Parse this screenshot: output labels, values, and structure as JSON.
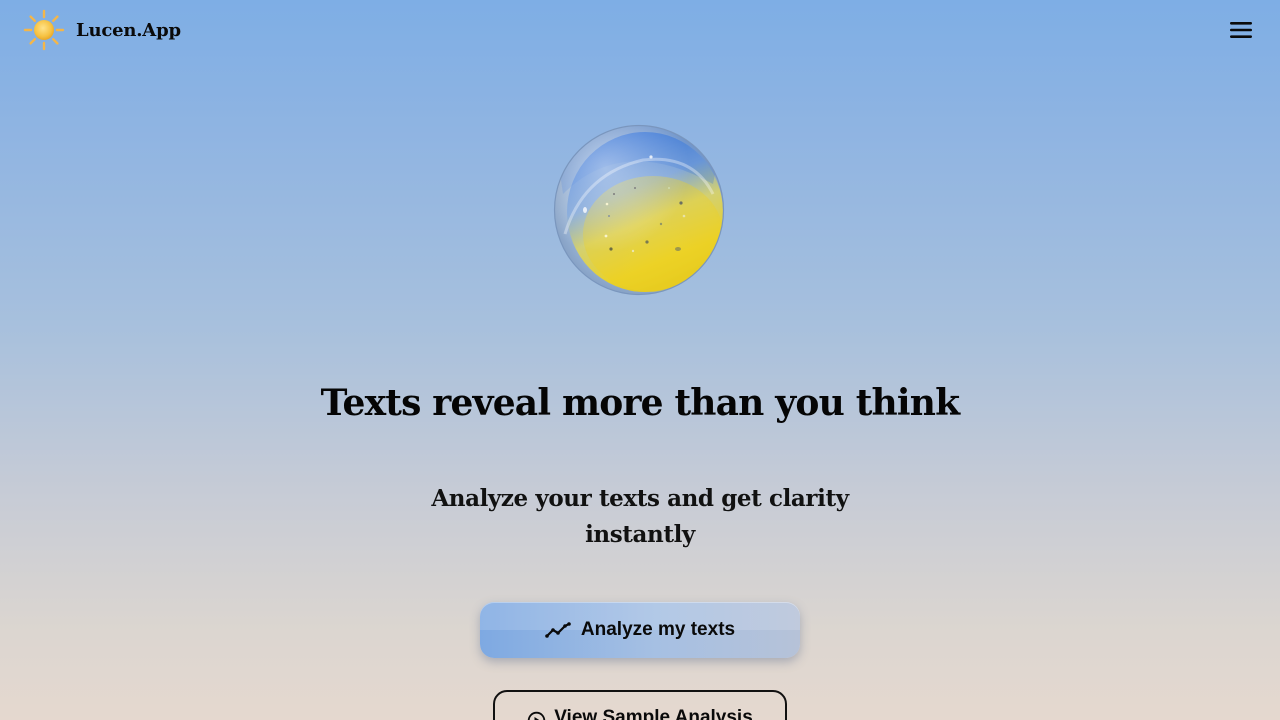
{
  "header": {
    "brand_name": "Lucen.App",
    "logo_icon": "sun-icon",
    "menu_icon": "hamburger-menu-icon"
  },
  "hero": {
    "orb_icon": "glass-orb-illustration",
    "headline": "Texts reveal more than you think",
    "subheadline": "Analyze your texts and get clarity instantly"
  },
  "actions": {
    "primary_label": "Analyze my texts",
    "primary_icon": "trend-line-icon",
    "secondary_label": "View Sample Analysis",
    "secondary_icon": "play-circle-icon"
  },
  "colors": {
    "sun": "#f6c242",
    "orb_blue": "#3a78d8",
    "orb_yellow": "#f0d21e",
    "text": "#0a0a0a"
  }
}
